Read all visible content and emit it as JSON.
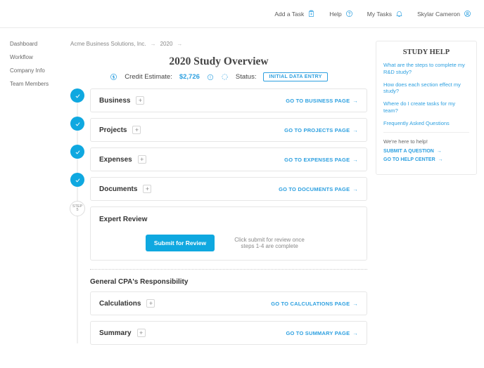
{
  "header": {
    "add_task": "Add a Task",
    "help": "Help",
    "my_tasks": "My Tasks",
    "user_name": "Skylar Cameron"
  },
  "sidebar": {
    "items": [
      "Dashboard",
      "Workflow",
      "Company Info",
      "Team Members"
    ]
  },
  "breadcrumb": {
    "company": "Acme Business Solutions, Inc.",
    "year": "2020"
  },
  "overview": {
    "title": "2020 Study Overview",
    "credit_label": "Credit Estimate:",
    "credit_value": "$2,726",
    "status_label": "Status:",
    "status_value": "INITIAL DATA ENTRY"
  },
  "steps": {
    "step5_label_top": "STEP",
    "step5_label_num": "5"
  },
  "cards": {
    "business": {
      "title": "Business",
      "goto": "GO TO BUSINESS PAGE"
    },
    "projects": {
      "title": "Projects",
      "goto": "GO TO PROJECTS PAGE"
    },
    "expenses": {
      "title": "Expenses",
      "goto": "GO TO EXPENSES PAGE"
    },
    "documents": {
      "title": "Documents",
      "goto": "GO TO DOCUMENTS PAGE"
    },
    "calculations": {
      "title": "Calculations",
      "goto": "GO TO CALCULATIONS PAGE"
    },
    "summary": {
      "title": "Summary",
      "goto": "GO TO SUMMARY PAGE"
    }
  },
  "expert": {
    "title": "Expert Review",
    "submit_label": "Submit for Review",
    "hint": "Click submit for review once steps 1-4 are complete"
  },
  "section_cpa": "General CPA's Responsibility",
  "help_panel": {
    "title": "STUDY HELP",
    "links": [
      "What are the steps to complete my R&D study?",
      "How does each section effect my study?",
      "Where do I create tasks for my team?",
      "Frequently Asked Questions"
    ],
    "sub": "We're here to help!",
    "actions": [
      "SUBMIT A QUESTION",
      "GO TO HELP CENTER"
    ]
  }
}
